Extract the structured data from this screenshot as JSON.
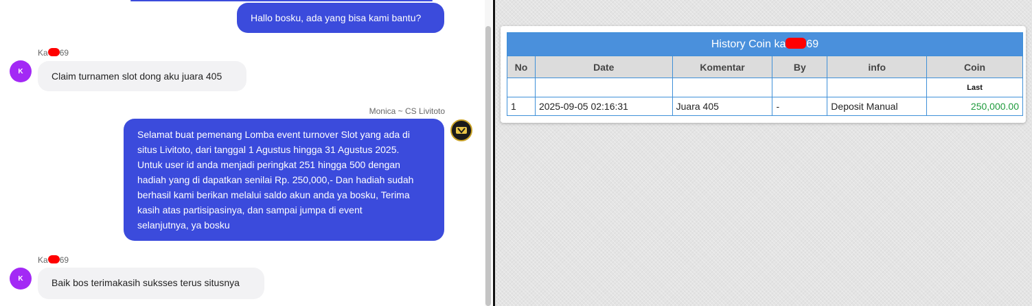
{
  "chat": {
    "messages": [
      {
        "type": "outgoing",
        "text": "Hallo bosku, ada yang bisa kami bantu?"
      },
      {
        "type": "incoming",
        "sender_prefix": "Ka",
        "sender_suffix": "69",
        "avatar": "K",
        "text": "Claim turnamen slot dong aku juara 405"
      },
      {
        "type": "outgoing",
        "sender": "Monica ~ CS Livitoto",
        "lines": [
          "Selamat buat pemenang Lomba event turnover Slot yang ada di",
          "situs Livitoto, dari tanggal 1 Agustus hingga 31 Agustus 2025.",
          "Untuk user id anda menjadi peringkat 251 hingga 500 dengan",
          "hadiah yang di dapatkan senilai Rp. 250,000,- Dan hadiah sudah",
          "berhasil kami berikan melalui saldo akun anda ya bosku, Terima",
          "kasih atas partisipasinya, dan sampai jumpa di event",
          "selanjutnya, ya bosku"
        ]
      },
      {
        "type": "incoming",
        "sender_prefix": "Ka",
        "sender_suffix": "69",
        "avatar": "K",
        "text": "Baik bos terimakasih suksses terus situsnya"
      }
    ]
  },
  "history": {
    "title_prefix": "History Coin ka",
    "title_suffix": "69",
    "columns": [
      "No",
      "Date",
      "Komentar",
      "By",
      "info",
      "Coin"
    ],
    "subheader_coin": "Last",
    "rows": [
      {
        "no": "1",
        "date": "2025-09-05 02:16:31",
        "komentar": "Juara 405",
        "by": "-",
        "info": "Deposit Manual",
        "coin": "250,000.00"
      }
    ]
  },
  "colors": {
    "outgoing_bubble": "#3b4bdc",
    "incoming_bubble": "#f2f2f4",
    "user_avatar": "#a329f5",
    "table_header": "#4a90dc",
    "coin_value": "#1e9a3c",
    "redaction": "#ff0000"
  }
}
